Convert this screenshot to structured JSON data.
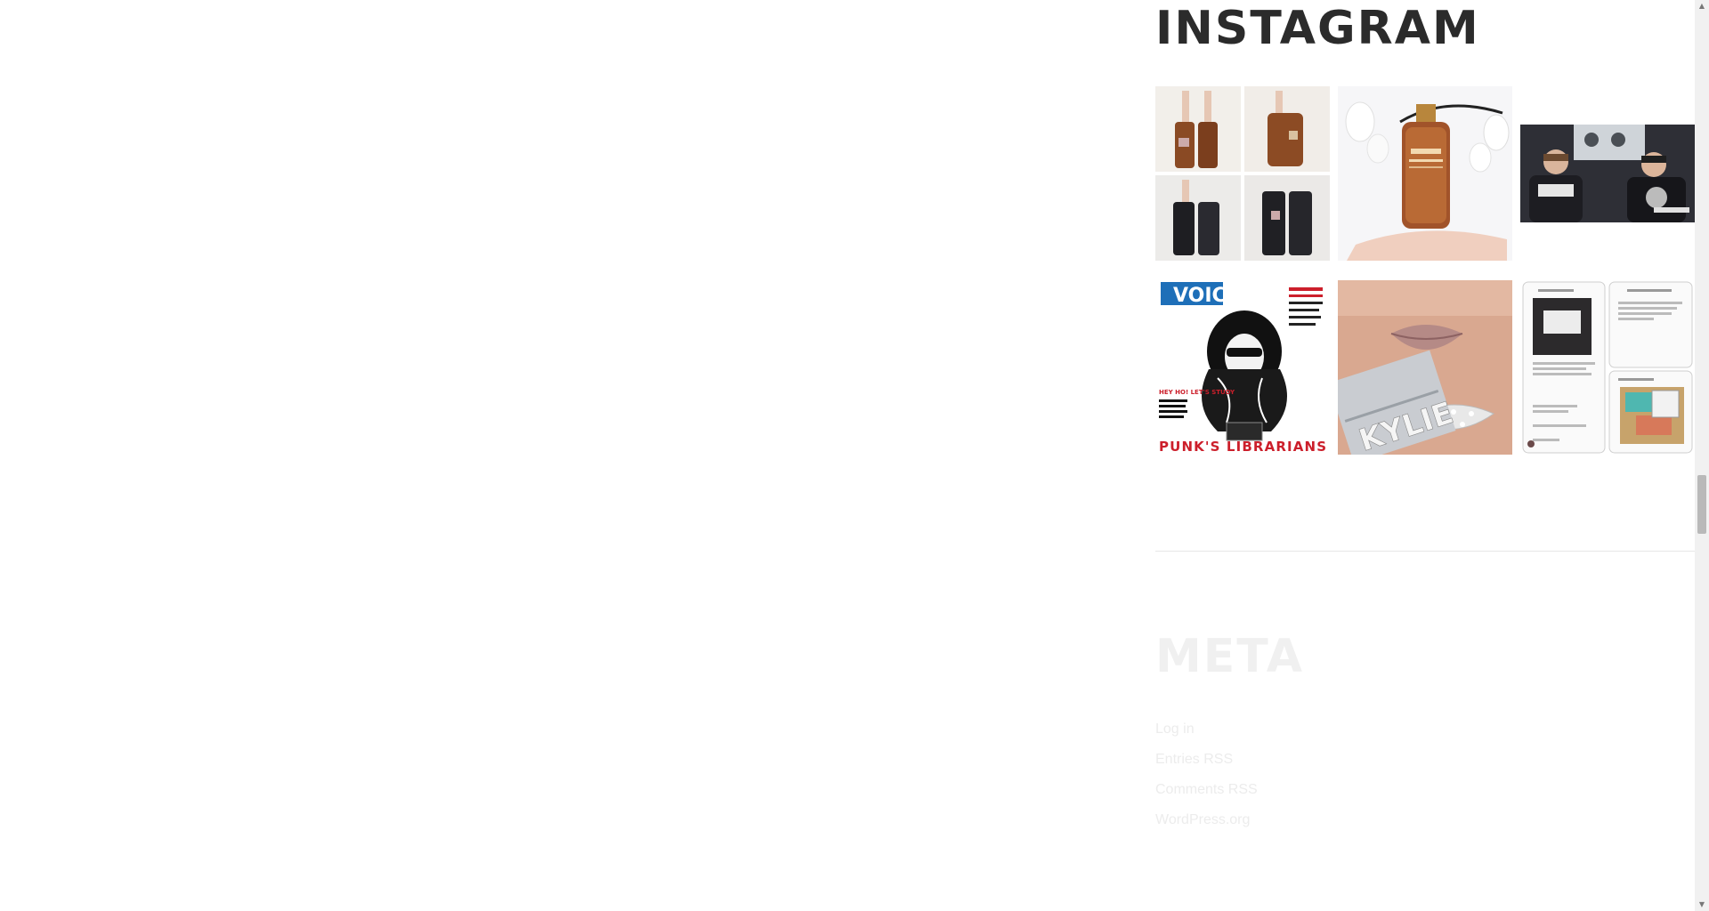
{
  "instagram": {
    "title": "INSTAGRAM",
    "posts": [
      {
        "icon": "boots-photo-icon"
      },
      {
        "icon": "nuxe-oil-photo-icon"
      },
      {
        "icon": "two-men-video-photo-icon"
      },
      {
        "icon": "voice-magazine-cover-icon",
        "cover_masthead": "VOIC",
        "cover_headline": "PUNK'S LIBRARIANS",
        "cover_kicker": "HEY HO! LET'S STUDY"
      },
      {
        "icon": "kylie-lipstick-photo-icon",
        "product_text": "KYLIE"
      },
      {
        "icon": "chat-screenshot-photo-icon"
      }
    ]
  },
  "meta": {
    "title": "META",
    "links": [
      {
        "label": "Log in"
      },
      {
        "label": "Entries RSS"
      },
      {
        "label": "Comments RSS"
      },
      {
        "label": "WordPress.org"
      }
    ]
  },
  "colors": {
    "title_dark": "#2b2b2b",
    "title_faint": "#f0f0f0",
    "link_faint": "#ececec",
    "divider": "#e6e6e6",
    "scrollbar_track": "#f1f1f1",
    "scrollbar_thumb": "#b9b9b9"
  }
}
